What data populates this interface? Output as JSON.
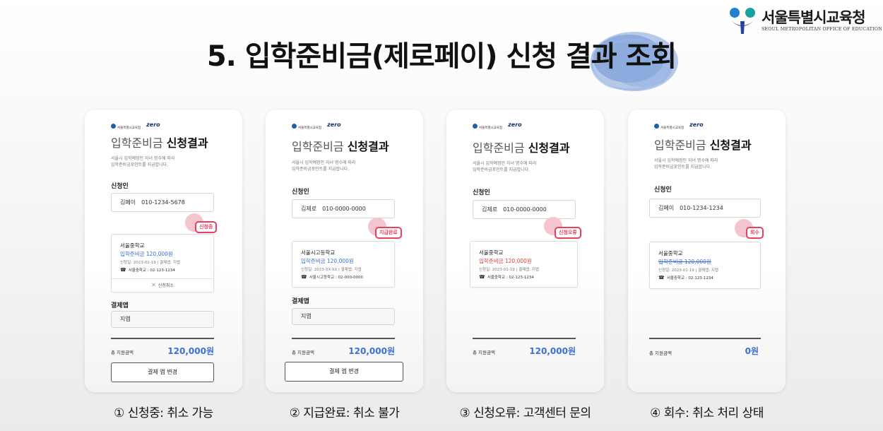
{
  "org_logo": {
    "name": "서울특별시교육청",
    "subtitle": "SEOUL METROPOLITAN OFFICE OF EDUCATION"
  },
  "page_title": "5. 입학준비금(제로페이) 신청 결과 조회",
  "card_common": {
    "heading_light": "입학준비금",
    "heading_bold": "신청결과",
    "desc_line1": "서울시 입학예정인 자녀 명수에 따라",
    "desc_line2": "입학준비금포인트를 지급합니다.",
    "applicant_label": "신청인",
    "app_label": "결제앱",
    "total_label": "총 지원금액",
    "change_button": "결제 앱 변경",
    "cancel_label": "신청취소",
    "mini_org": "서울특별시교육청",
    "mini_zero": "zero"
  },
  "cards": [
    {
      "applicant_name": "김페이",
      "applicant_phone": "010-1234-5678",
      "status": "신청중",
      "school": "서울중학교",
      "benefit": "입학준비금 120,000원",
      "meta": "신청일: 2023-01-19  |  결제앱: 지앱",
      "school_phone": "서울중학교 : 02-123-1234",
      "app_value": "지앱",
      "total_amount": "120,000원",
      "caption": "① 신청중: 취소 가능"
    },
    {
      "applicant_name": "김제로",
      "applicant_phone": "010-0000-0000",
      "status": "지급완료",
      "school": "서울시고등학교",
      "benefit": "입학준비금 120,000원",
      "meta": "신청일: 2023-XX-XX  |  결제앱: 지앱",
      "school_phone": "서울시고등학교 : 02-000-0000",
      "app_value": "지앱",
      "total_amount": "120,000원",
      "caption": "② 지급완료: 취소 불가"
    },
    {
      "applicant_name": "김제로",
      "applicant_phone": "010-0000-0000",
      "status": "신청오류",
      "school": "서울중학교",
      "benefit": "입학준비금 120,000원",
      "meta": "신청일: 2023-01-19  |  결제앱: 지앱",
      "school_phone": "서울중학교 : 02-123-1234",
      "total_amount": "120,000원",
      "caption": "③ 신청오류: 고객센터 문의"
    },
    {
      "applicant_name": "김페이",
      "applicant_phone": "010-1234-1234",
      "status": "회수",
      "school": "서울중학교",
      "benefit": "입학준비금 120,000원",
      "meta": "신청일: 2023-01-19  |  결제앱: 지앱",
      "school_phone": "서울중학교 : 02-123-1234",
      "total_amount": "0원",
      "caption": "④ 회수: 취소 처리 상태"
    }
  ],
  "colors": {
    "status_red": "#e6415f",
    "amount_blue": "#3b6fd4",
    "error_red": "#e33b3b",
    "brush_blue": "#7d9fd8"
  }
}
